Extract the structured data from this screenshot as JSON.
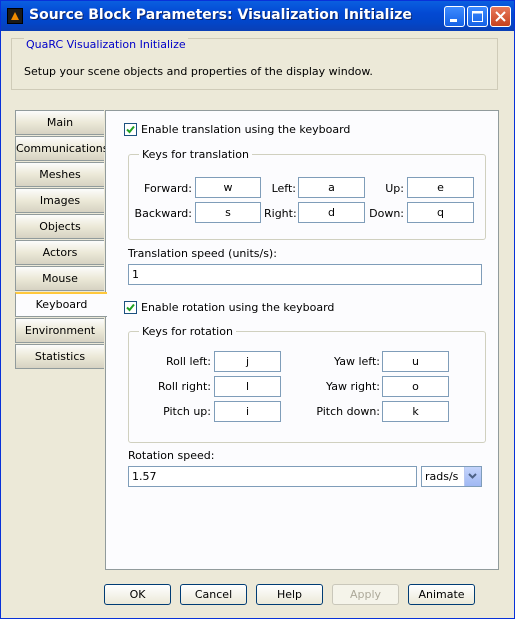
{
  "window": {
    "title": "Source Block Parameters: Visualization Initialize"
  },
  "header": {
    "group_label": "QuaRC Visualization Initialize",
    "description": "Setup your scene objects and properties of the display window."
  },
  "tabs": [
    {
      "label": "Main",
      "active": false
    },
    {
      "label": "Communications",
      "active": false
    },
    {
      "label": "Meshes",
      "active": false
    },
    {
      "label": "Images",
      "active": false
    },
    {
      "label": "Objects",
      "active": false
    },
    {
      "label": "Actors",
      "active": false
    },
    {
      "label": "Mouse",
      "active": false
    },
    {
      "label": "Keyboard",
      "active": true
    },
    {
      "label": "Environment",
      "active": false
    },
    {
      "label": "Statistics",
      "active": false
    }
  ],
  "translation": {
    "enable_label": "Enable translation using the keyboard",
    "enabled": true,
    "group_label": "Keys for translation",
    "forward_label": "Forward:",
    "forward_value": "w",
    "left_label": "Left:",
    "left_value": "a",
    "up_label": "Up:",
    "up_value": "e",
    "backward_label": "Backward:",
    "backward_value": "s",
    "right_label": "Right:",
    "right_value": "d",
    "down_label": "Down:",
    "down_value": "q",
    "speed_label": "Translation speed (units/s):",
    "speed_value": "1"
  },
  "rotation": {
    "enable_label": "Enable rotation using the keyboard",
    "enabled": true,
    "group_label": "Keys for rotation",
    "roll_left_label": "Roll left:",
    "roll_left_value": "j",
    "yaw_left_label": "Yaw left:",
    "yaw_left_value": "u",
    "roll_right_label": "Roll right:",
    "roll_right_value": "l",
    "yaw_right_label": "Yaw right:",
    "yaw_right_value": "o",
    "pitch_up_label": "Pitch up:",
    "pitch_up_value": "i",
    "pitch_down_label": "Pitch down:",
    "pitch_down_value": "k",
    "speed_label": "Rotation speed:",
    "speed_value": "1.57",
    "speed_unit": "rads/s"
  },
  "buttons": {
    "ok": "OK",
    "cancel": "Cancel",
    "help": "Help",
    "apply": "Apply",
    "animate": "Animate"
  },
  "colors": {
    "title_bar": "#0349d3",
    "header_label": "#0000c8",
    "active_tab_accent": "#ffc83c"
  }
}
